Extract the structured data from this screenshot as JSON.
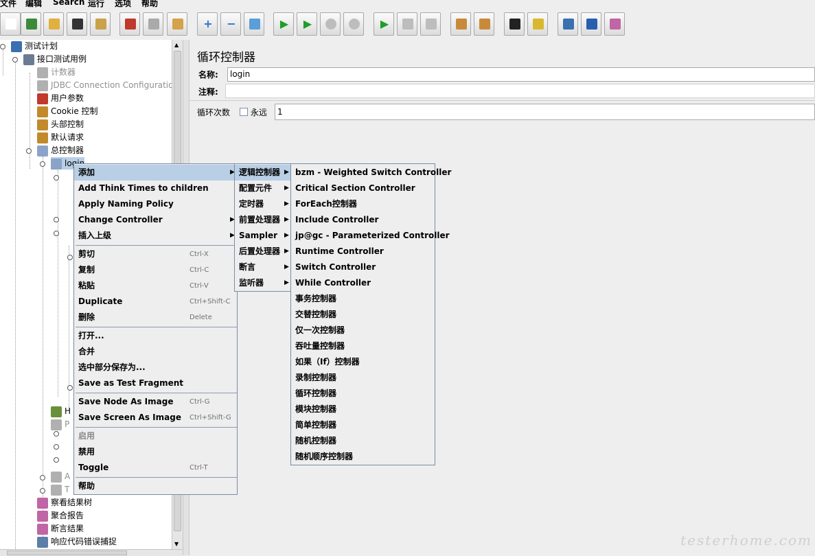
{
  "menubar": [
    "文件",
    "编辑",
    "Search",
    "运行",
    "选项",
    "帮助"
  ],
  "toolbar_icons": [
    "new-icon",
    "templates-icon",
    "open-icon",
    "save-icon",
    "save-as-icon",
    "cut-icon",
    "copy-icon",
    "paste-icon",
    "expand-icon",
    "collapse-icon",
    "toggle-icon",
    "start-icon",
    "start-no-pause-icon",
    "stop-icon",
    "shutdown-icon",
    "remote-start-icon",
    "remote-stop-icon",
    "remote-shutdown-icon",
    "clear-icon",
    "clear-all-icon",
    "search-icon",
    "reset-search-icon",
    "function-helper-icon",
    "help-icon",
    "log-viewer-icon"
  ],
  "tree": [
    {
      "label": "测试计划",
      "icon": "flask-icon",
      "color": "#3a6fb0"
    },
    {
      "label": "接口测试用例",
      "icon": "gear-icon",
      "color": "#6a7c93"
    },
    {
      "label": "计数器",
      "icon": "tools-icon",
      "color": "#b0b0b0",
      "disabled": true
    },
    {
      "label": "JDBC Connection Configuration",
      "icon": "tools-icon",
      "color": "#b0b0b0",
      "disabled": true
    },
    {
      "label": "用户参数",
      "icon": "arrow-icon",
      "color": "#c0392b"
    },
    {
      "label": "Cookie 控制",
      "icon": "tools-icon",
      "color": "#c28a2a"
    },
    {
      "label": "头部控制",
      "icon": "tools-icon",
      "color": "#c28a2a"
    },
    {
      "label": "默认请求",
      "icon": "tools-icon",
      "color": "#c28a2a"
    },
    {
      "label": "总控制器",
      "icon": "controller-icon",
      "color": "#8ba3c7"
    },
    {
      "label": "login",
      "icon": "controller-icon",
      "color": "#8ba3c7"
    }
  ],
  "tree_bottom": [
    {
      "label": "察看结果树",
      "icon": "graph-icon",
      "color": "#c065a5"
    },
    {
      "label": "聚合报告",
      "icon": "graph-icon",
      "color": "#c065a5"
    },
    {
      "label": "断言结果",
      "icon": "graph-icon",
      "color": "#c065a5"
    },
    {
      "label": "响应代码错误捕捉",
      "icon": "magnifier-icon",
      "color": "#5b7fa8"
    }
  ],
  "tree_partial": [
    {
      "label": "H",
      "icon": "pencil-icon",
      "color": "#6a8f3a"
    },
    {
      "label": "P",
      "icon": "controller-icon",
      "color": "#b0b0b0",
      "disabled": true
    },
    {
      "label": "A",
      "icon": "controller-icon",
      "color": "#b0b0b0",
      "disabled": true
    },
    {
      "label": "T",
      "icon": "controller-icon",
      "color": "#b0b0b0",
      "disabled": true
    }
  ],
  "panel": {
    "title": "循环控制器",
    "name_label": "名称:",
    "name_value": "login",
    "comment_label": "注释:",
    "comment_value": "",
    "loop_label": "循环次数",
    "forever_label": "永远",
    "forever_checked": false,
    "loop_value": "1"
  },
  "context_menu": [
    {
      "label": "添加",
      "arrow": true,
      "highlight": true
    },
    {
      "label": "Add Think Times to children"
    },
    {
      "label": "Apply Naming Policy"
    },
    {
      "label": "Change Controller",
      "arrow": true
    },
    {
      "label": "插入上级",
      "arrow": true
    },
    {
      "sep": true
    },
    {
      "label": "剪切",
      "accel": "Ctrl-X"
    },
    {
      "label": "复制",
      "accel": "Ctrl-C"
    },
    {
      "label": "粘贴",
      "accel": "Ctrl-V"
    },
    {
      "label": "Duplicate",
      "accel": "Ctrl+Shift-C"
    },
    {
      "label": "删除",
      "accel": "Delete"
    },
    {
      "sep": true
    },
    {
      "label": "打开..."
    },
    {
      "label": "合并"
    },
    {
      "label": "选中部分保存为..."
    },
    {
      "label": "Save as Test Fragment"
    },
    {
      "sep": true
    },
    {
      "label": "Save Node As Image",
      "accel": "Ctrl-G"
    },
    {
      "label": "Save Screen As Image",
      "accel": "Ctrl+Shift-G"
    },
    {
      "sep": true
    },
    {
      "label": "启用",
      "disabled": true
    },
    {
      "label": "禁用"
    },
    {
      "label": "Toggle",
      "accel": "Ctrl-T"
    },
    {
      "sep": true
    },
    {
      "label": "帮助"
    }
  ],
  "add_submenu": [
    {
      "label": "逻辑控制器",
      "arrow": true,
      "highlight": true
    },
    {
      "label": "配置元件",
      "arrow": true
    },
    {
      "label": "定时器",
      "arrow": true
    },
    {
      "label": "前置处理器",
      "arrow": true
    },
    {
      "label": "Sampler",
      "arrow": true
    },
    {
      "label": "后置处理器",
      "arrow": true
    },
    {
      "label": "断言",
      "arrow": true
    },
    {
      "label": "监听器",
      "arrow": true
    }
  ],
  "logic_submenu": [
    "bzm - Weighted Switch Controller",
    "Critical Section Controller",
    "ForEach控制器",
    "Include Controller",
    "jp@gc - Parameterized Controller",
    "Runtime Controller",
    "Switch Controller",
    "While Controller",
    "事务控制器",
    "交替控制器",
    "仅一次控制器",
    "吞吐量控制器",
    "如果（If）控制器",
    "录制控制器",
    "循环控制器",
    "模块控制器",
    "简单控制器",
    "随机控制器",
    "随机顺序控制器"
  ],
  "watermark": "testerhome.com"
}
